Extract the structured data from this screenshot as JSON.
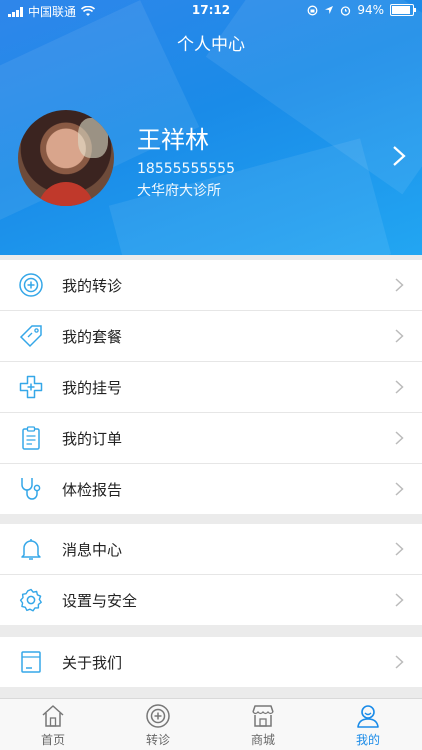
{
  "status_bar": {
    "carrier": "中国联通",
    "time": "17:12",
    "battery": "94%"
  },
  "header": {
    "title": "个人中心",
    "user": {
      "name": "王祥林",
      "phone": "18555555555",
      "clinic": "大华府大诊所"
    }
  },
  "menu": {
    "group1": [
      {
        "label": "我的转诊",
        "icon": "referral-icon"
      },
      {
        "label": "我的套餐",
        "icon": "tag-icon"
      },
      {
        "label": "我的挂号",
        "icon": "medical-cross-icon"
      },
      {
        "label": "我的订单",
        "icon": "clipboard-icon"
      },
      {
        "label": "体检报告",
        "icon": "stethoscope-icon"
      }
    ],
    "group2": [
      {
        "label": "消息中心",
        "icon": "bell-icon"
      },
      {
        "label": "设置与安全",
        "icon": "gear-icon"
      }
    ],
    "group3": [
      {
        "label": "关于我们",
        "icon": "info-page-icon"
      }
    ]
  },
  "tabs": [
    {
      "label": "首页",
      "icon": "home-icon",
      "active": false
    },
    {
      "label": "转诊",
      "icon": "referral-icon",
      "active": false
    },
    {
      "label": "商城",
      "icon": "shop-icon",
      "active": false
    },
    {
      "label": "我的",
      "icon": "user-icon",
      "active": true
    }
  ],
  "colors": {
    "accent": "#1a8be8",
    "icon": "#35a7e8"
  }
}
